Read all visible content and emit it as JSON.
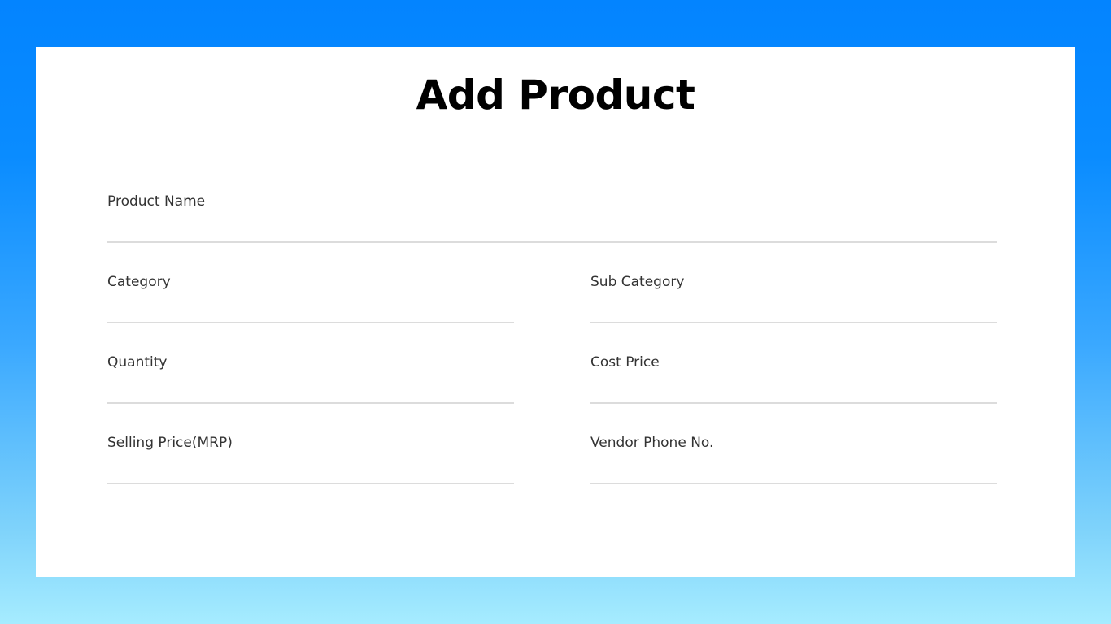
{
  "form": {
    "title": "Add Product",
    "fields": {
      "product_name": {
        "label": "Product Name",
        "value": "",
        "placeholder": ""
      },
      "category": {
        "label": "Category",
        "value": "",
        "placeholder": ""
      },
      "sub_category": {
        "label": "Sub Category",
        "value": "",
        "placeholder": ""
      },
      "quantity": {
        "label": "Quantity",
        "value": "",
        "placeholder": ""
      },
      "cost_price": {
        "label": "Cost Price",
        "value": "",
        "placeholder": ""
      },
      "selling_price": {
        "label": "Selling Price(MRP)",
        "value": "",
        "placeholder": ""
      },
      "vendor_phone": {
        "label": "Vendor Phone No.",
        "value": "",
        "placeholder": ""
      }
    }
  },
  "colors": {
    "background_top": "#0384ff",
    "background_bottom": "#a6ecff",
    "card": "#ffffff",
    "underline": "#dcdcdc",
    "label_text": "#333333",
    "title_text": "#000000"
  }
}
